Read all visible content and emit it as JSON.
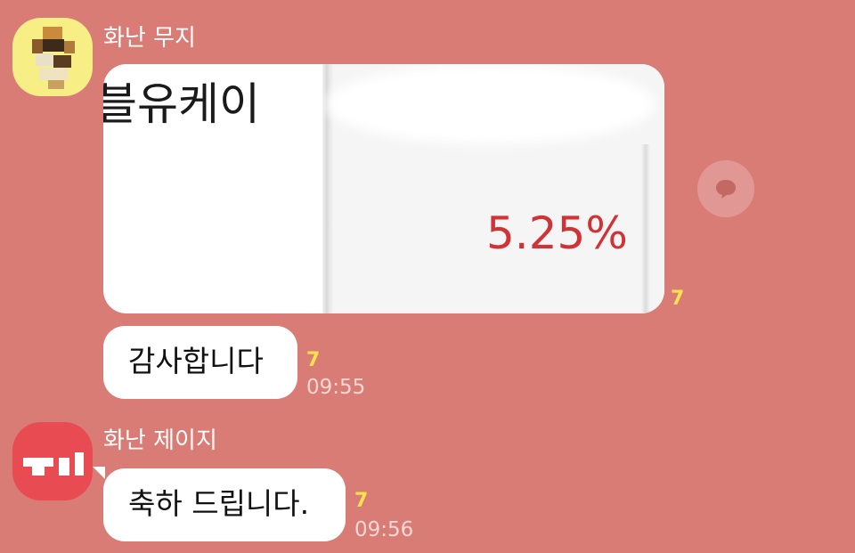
{
  "messages": [
    {
      "sender": "화난 무지",
      "image": {
        "label": "블유케이",
        "rate": "5.25%"
      },
      "image_unread": "7",
      "text": "감사합니다",
      "unread": "7",
      "time": "09:55"
    },
    {
      "sender": "화난 제이지",
      "text": "축하 드립니다.",
      "unread": "7",
      "time": "09:56"
    }
  ],
  "colors": {
    "background": "#d97c76",
    "bubble": "#ffffff",
    "unread": "#ffe24d",
    "rate": "#d13236"
  },
  "icons": {
    "share": "speech-bubble-icon"
  }
}
